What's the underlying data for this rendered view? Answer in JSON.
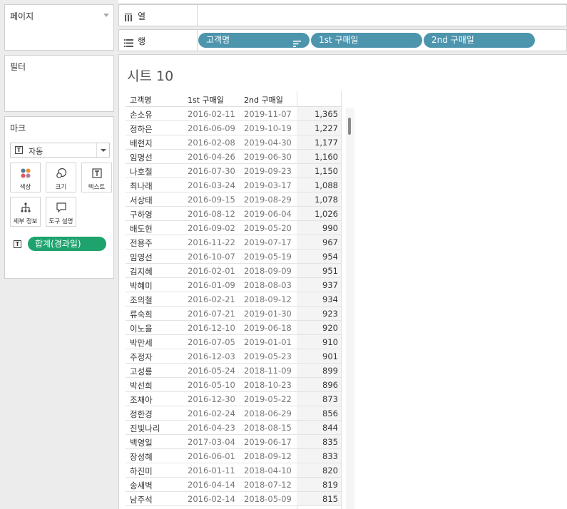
{
  "left": {
    "pages_title": "페이지",
    "filters_title": "필터",
    "marks_title": "마크",
    "mark_type": "자동",
    "mark_buttons": {
      "color": "색상",
      "size": "크기",
      "label": "텍스트",
      "detail": "세부 정보",
      "tooltip": "도구 설명"
    },
    "text_pill": "합계(경과일)"
  },
  "shelves": {
    "columns_label": "열",
    "rows_label": "행",
    "row_pills": [
      "고객명",
      "1st 구매일",
      "2nd 구매일"
    ]
  },
  "sheet": {
    "title": "시트 10",
    "headers": [
      "고객명",
      "1st 구매일",
      "2nd 구매일"
    ],
    "rows": [
      [
        "손소유",
        "2016-02-11",
        "2019-11-07",
        "1,365"
      ],
      [
        "정하은",
        "2016-06-09",
        "2019-10-19",
        "1,227"
      ],
      [
        "배현지",
        "2016-02-08",
        "2019-04-30",
        "1,177"
      ],
      [
        "임명선",
        "2016-04-26",
        "2019-06-30",
        "1,160"
      ],
      [
        "나호철",
        "2016-07-30",
        "2019-09-23",
        "1,150"
      ],
      [
        "최나래",
        "2016-03-24",
        "2019-03-17",
        "1,088"
      ],
      [
        "서상태",
        "2016-09-15",
        "2019-08-29",
        "1,078"
      ],
      [
        "구하영",
        "2016-08-12",
        "2019-06-04",
        "1,026"
      ],
      [
        "배도현",
        "2016-09-02",
        "2019-05-20",
        "990"
      ],
      [
        "전용주",
        "2016-11-22",
        "2019-07-17",
        "967"
      ],
      [
        "임영선",
        "2016-10-07",
        "2019-05-19",
        "954"
      ],
      [
        "김지혜",
        "2016-02-01",
        "2018-09-09",
        "951"
      ],
      [
        "박혜미",
        "2016-01-09",
        "2018-08-03",
        "937"
      ],
      [
        "조의철",
        "2016-02-21",
        "2018-09-12",
        "934"
      ],
      [
        "류숙희",
        "2016-07-21",
        "2019-01-30",
        "923"
      ],
      [
        "이노을",
        "2016-12-10",
        "2019-06-18",
        "920"
      ],
      [
        "박만세",
        "2016-07-05",
        "2019-01-01",
        "910"
      ],
      [
        "주정자",
        "2016-12-03",
        "2019-05-23",
        "901"
      ],
      [
        "고성룡",
        "2016-05-24",
        "2018-11-09",
        "899"
      ],
      [
        "박선희",
        "2016-05-10",
        "2018-10-23",
        "896"
      ],
      [
        "조채아",
        "2016-12-30",
        "2019-05-22",
        "873"
      ],
      [
        "정한경",
        "2016-02-24",
        "2018-06-29",
        "856"
      ],
      [
        "진빛나리",
        "2016-04-23",
        "2018-08-15",
        "844"
      ],
      [
        "백영일",
        "2017-03-04",
        "2019-06-17",
        "835"
      ],
      [
        "장성혜",
        "2016-06-01",
        "2018-09-12",
        "833"
      ],
      [
        "하진미",
        "2016-01-11",
        "2018-04-10",
        "820"
      ],
      [
        "송새벽",
        "2016-04-14",
        "2018-07-12",
        "819"
      ],
      [
        "남주석",
        "2016-02-14",
        "2018-05-09",
        "815"
      ]
    ]
  }
}
